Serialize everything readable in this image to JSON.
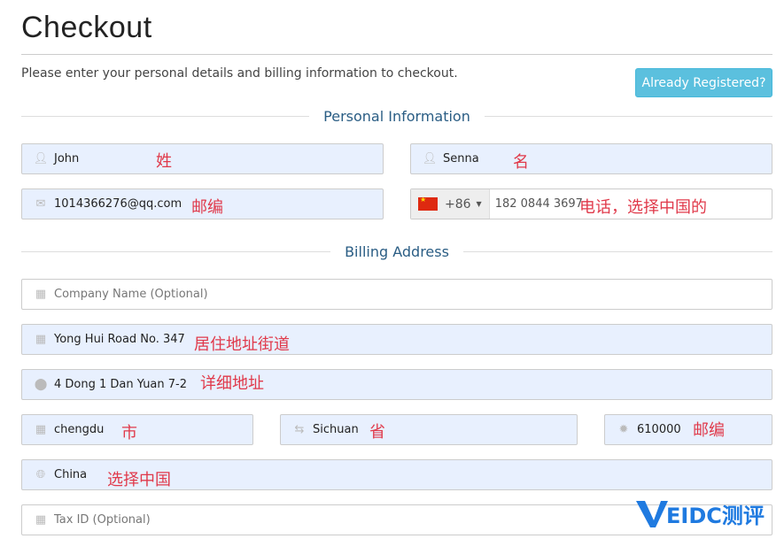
{
  "header": {
    "title": "Checkout",
    "subtitle": "Please enter your personal details and billing information to checkout.",
    "already_registered": "Already Registered?"
  },
  "sections": {
    "personal": "Personal Information",
    "billing": "Billing Address"
  },
  "fields": {
    "first_name": "John",
    "last_name": "Senna",
    "email": "1014366276@qq.com",
    "phone_code": "+86",
    "phone": "182 0844 3697",
    "company_placeholder": "Company Name (Optional)",
    "address1": "Yong Hui Road No. 347",
    "address2": "4 Dong 1 Dan Yuan 7-2",
    "city": "chengdu",
    "state": "Sichuan",
    "postcode": "610000",
    "country": "China",
    "tax_placeholder": "Tax ID (Optional)"
  },
  "annotations": {
    "first_name": "姓",
    "last_name": "名",
    "email": "邮编",
    "phone": "电话，选择中国的",
    "address1": "居住地址街道",
    "address2": "详细地址",
    "city": "市",
    "state": "省",
    "postcode": "邮编",
    "country": "选择中国"
  },
  "watermark": "VEIDC测评"
}
